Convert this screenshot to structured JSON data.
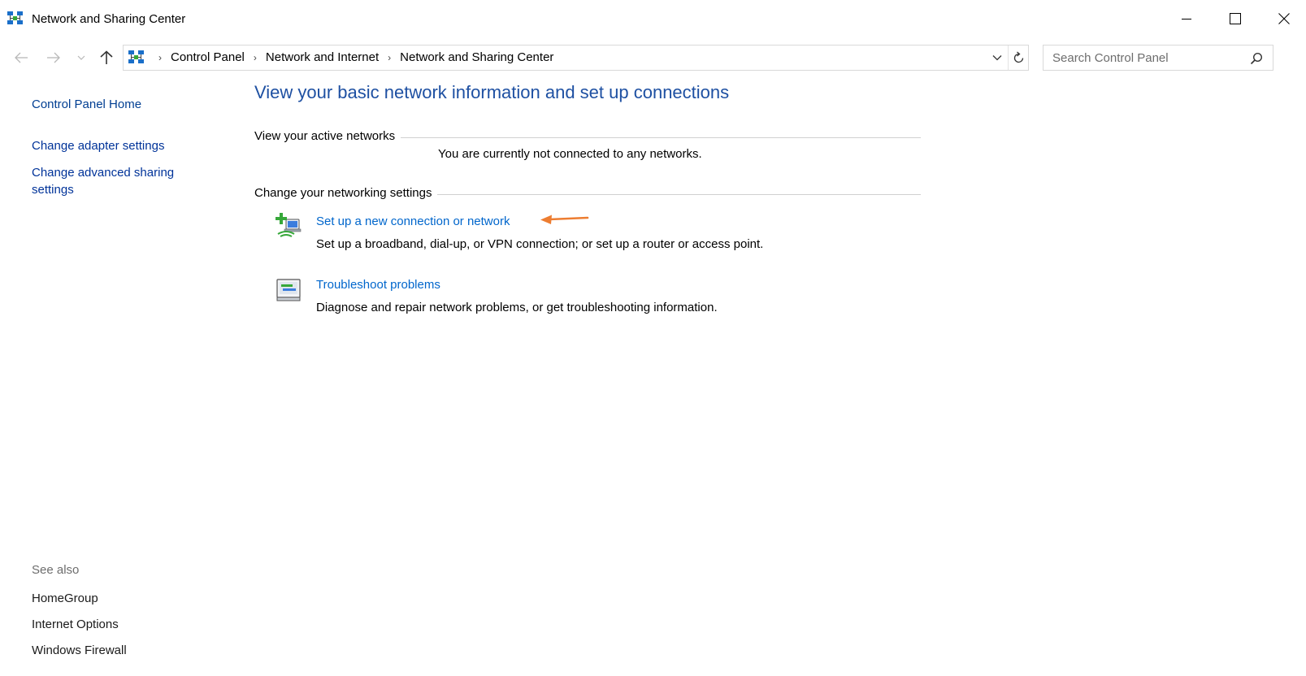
{
  "window": {
    "title": "Network and Sharing Center",
    "controls": [
      "minimize",
      "maximize",
      "close"
    ]
  },
  "address_bar": {
    "breadcrumbs": [
      {
        "label": "Control Panel"
      },
      {
        "label": "Network and Internet"
      },
      {
        "label": "Network and Sharing Center"
      }
    ]
  },
  "search": {
    "placeholder": "Search Control Panel",
    "value": ""
  },
  "left_nav": {
    "home": "Control Panel Home",
    "links": [
      {
        "label": "Change adapter settings"
      },
      {
        "label": "Change advanced sharing settings"
      }
    ],
    "see_also_heading": "See also",
    "see_also": [
      {
        "label": "HomeGroup"
      },
      {
        "label": "Internet Options"
      },
      {
        "label": "Windows Firewall"
      }
    ]
  },
  "main": {
    "title": "View your basic network information and set up connections",
    "active_networks": {
      "heading": "View your active networks",
      "status": "You are currently not connected to any networks."
    },
    "networking_settings": {
      "heading": "Change your networking settings",
      "tasks": [
        {
          "label": "Set up a new connection or network",
          "description": "Set up a broadband, dial-up, or VPN connection; or set up a router or access point.",
          "icon": "new-connection-icon"
        },
        {
          "label": "Troubleshoot problems",
          "description": "Diagnose and repair network problems, or get troubleshooting information.",
          "icon": "troubleshoot-icon"
        }
      ]
    }
  },
  "colors": {
    "link": "#0066cc",
    "title": "#1e50a2",
    "nav_link": "#003399",
    "annotation_arrow": "#ed7d31"
  }
}
